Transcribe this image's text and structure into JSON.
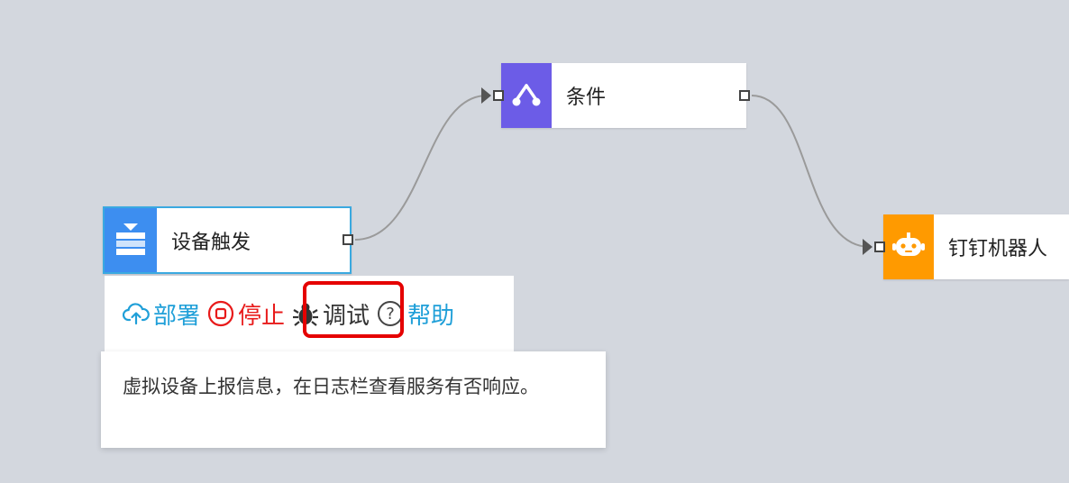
{
  "nodes": {
    "condition": {
      "label": "条件",
      "color": "#6c5ce7",
      "icon": "branch-icon"
    },
    "trigger": {
      "label": "设备触发",
      "color": "#3d8ef0",
      "icon": "device-trigger-icon"
    },
    "robot": {
      "label": "钉钉机器人",
      "color": "#ff9a00",
      "icon": "robot-icon"
    }
  },
  "toolbar": {
    "deploy": {
      "label": "部署",
      "icon": "cloud-upload-icon",
      "color": "#1f9fd8"
    },
    "stop": {
      "label": "停止",
      "icon": "stop-icon",
      "color": "#e81a1a"
    },
    "debug": {
      "label": "调试",
      "icon": "bug-icon",
      "color": "#333333"
    },
    "help": {
      "label": "帮助",
      "icon": "help-circle-icon",
      "color": "#1f9fd8"
    }
  },
  "tooltip": {
    "text": "虚拟设备上报信息，在日志栏查看服务有否响应。"
  },
  "highlight": {
    "target": "debug",
    "color": "#e50000"
  }
}
